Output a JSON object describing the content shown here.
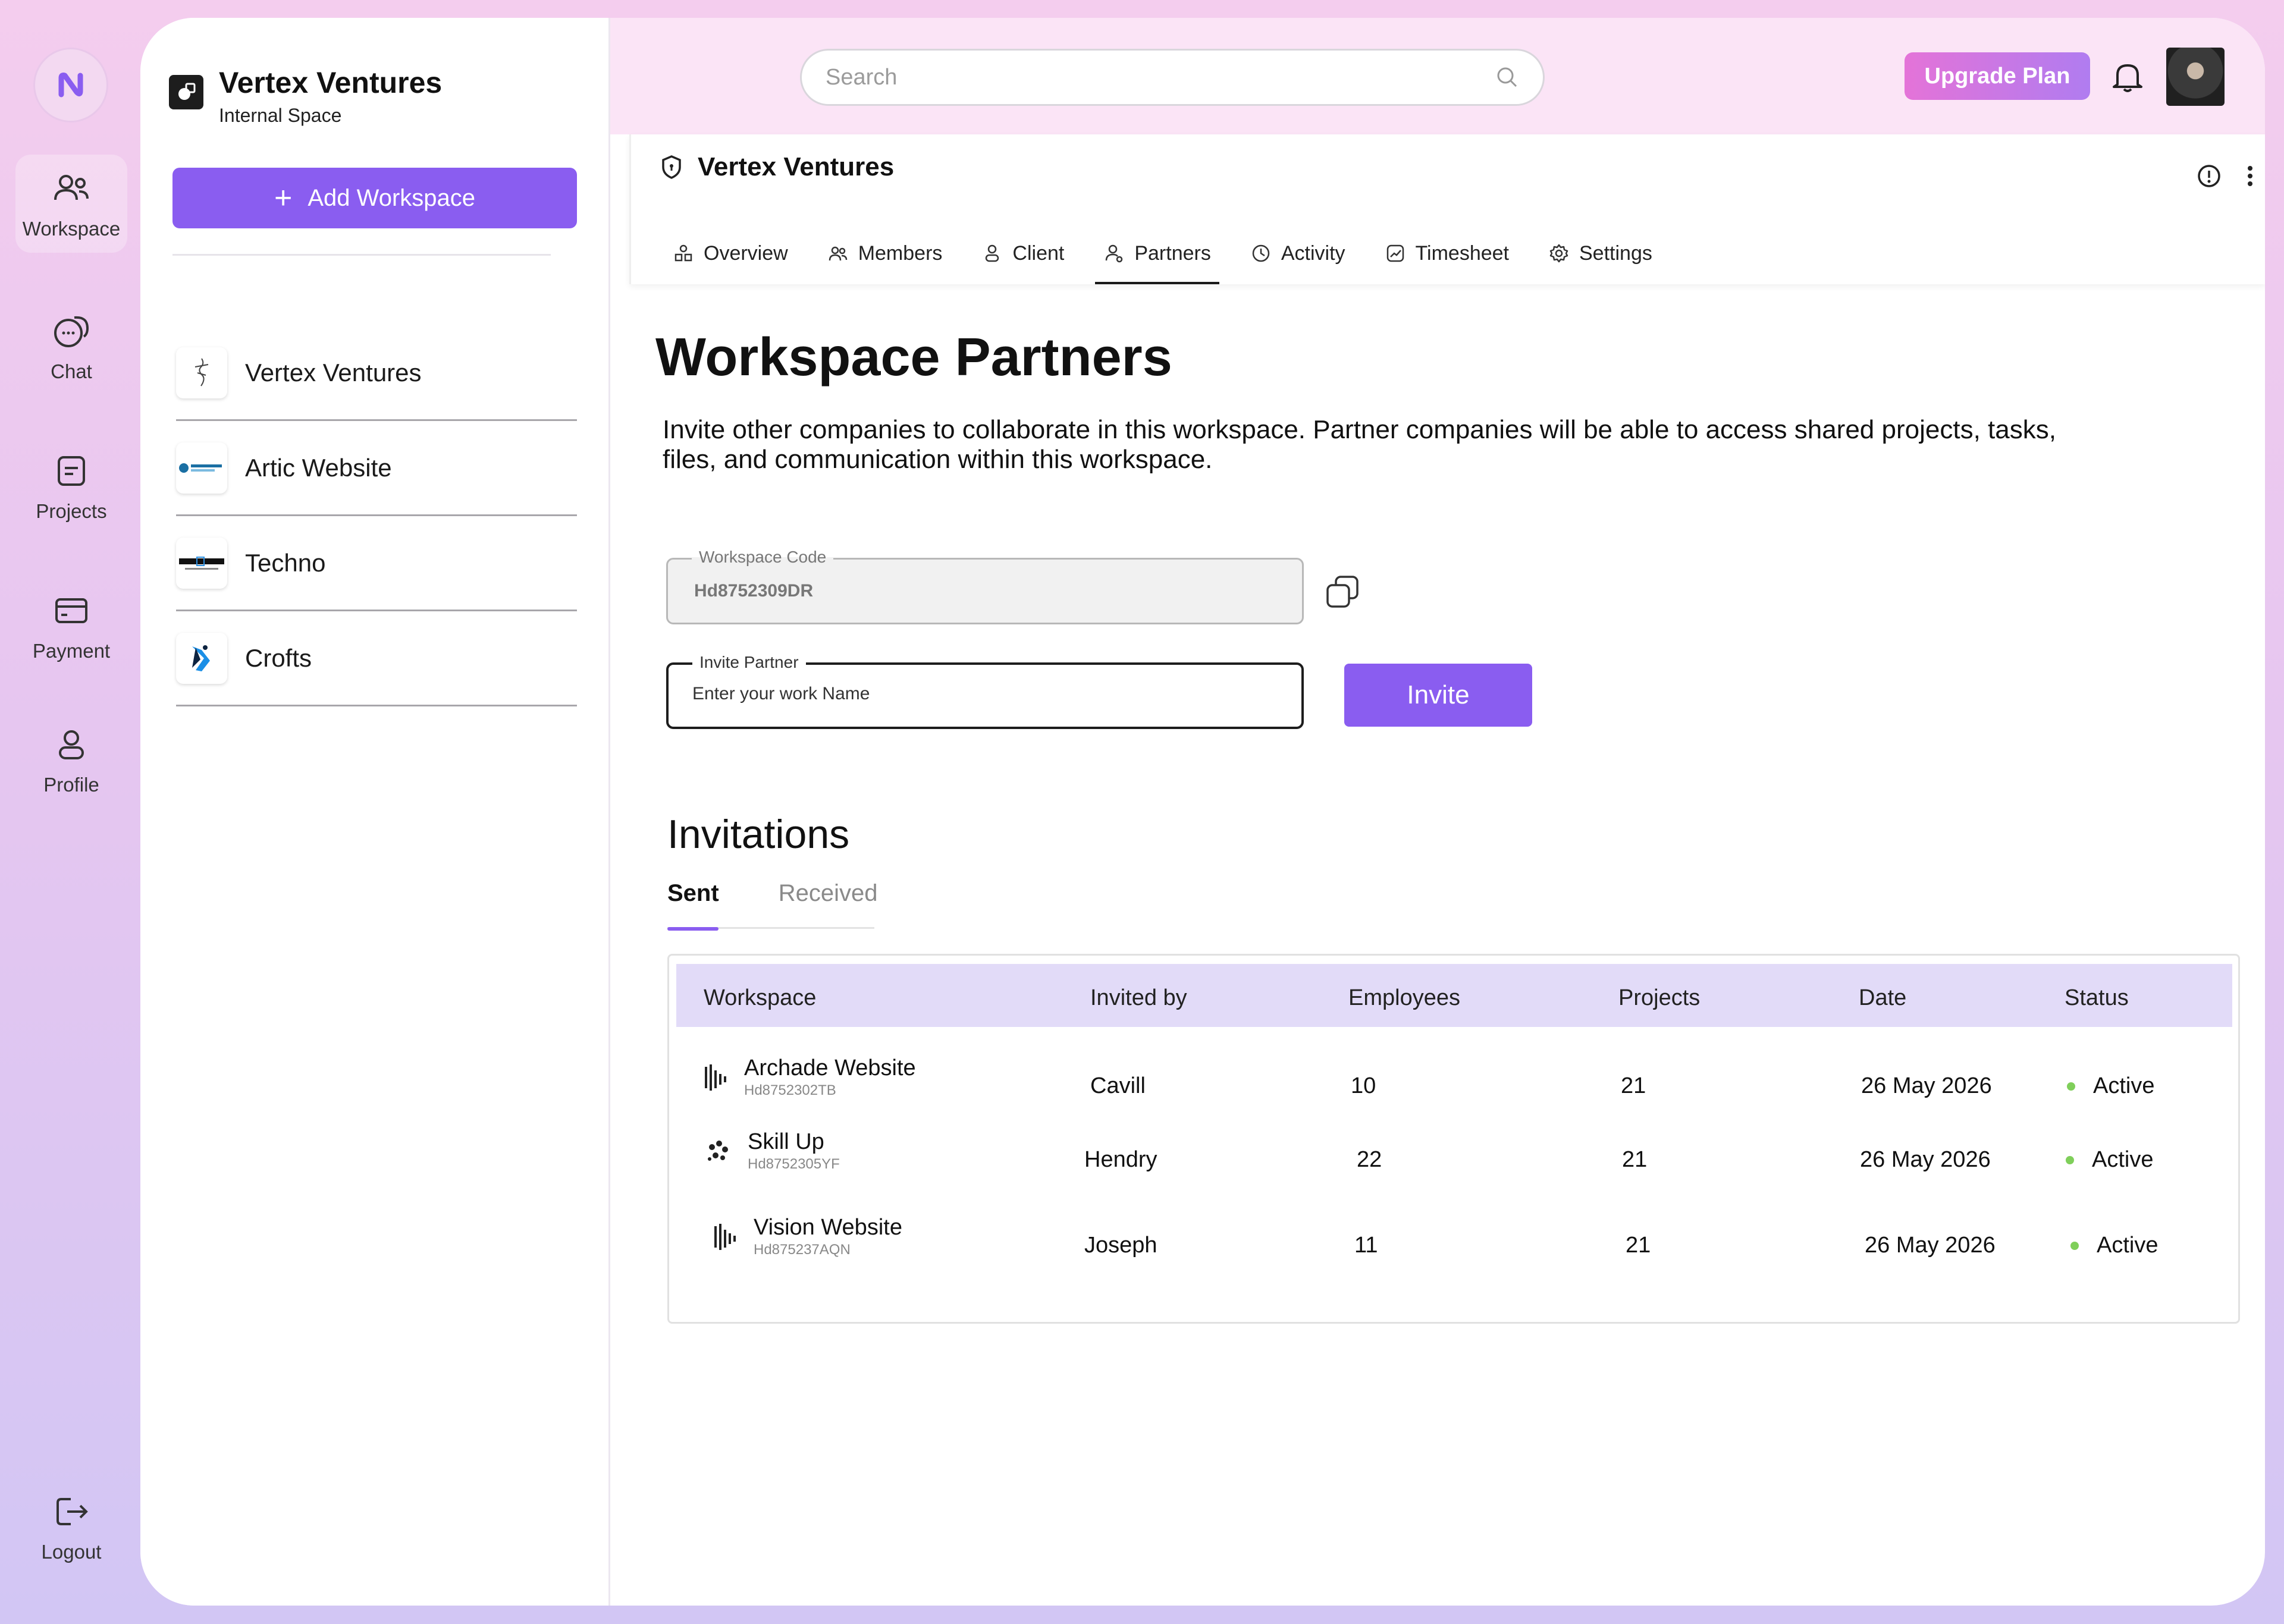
{
  "rail": {
    "items": [
      {
        "label": "Workspace",
        "icon": "users-icon"
      },
      {
        "label": "Chat",
        "icon": "chat-bubbles-icon"
      },
      {
        "label": "Projects",
        "icon": "document-icon"
      },
      {
        "label": "Payment",
        "icon": "card-icon"
      },
      {
        "label": "Profile",
        "icon": "person-icon"
      }
    ],
    "logout": "Logout"
  },
  "workspace_panel": {
    "title": "Vertex Ventures",
    "subtitle": "Internal Space",
    "add_button": "Add Workspace",
    "items": [
      {
        "name": "Vertex Ventures"
      },
      {
        "name": "Artic Website"
      },
      {
        "name": "Techno"
      },
      {
        "name": "Crofts"
      }
    ]
  },
  "topbar": {
    "search_placeholder": "Search",
    "upgrade_label": "Upgrade Plan"
  },
  "workspace_card": {
    "title": "Vertex Ventures",
    "tabs": [
      "Overview",
      "Members",
      "Client",
      "Partners",
      "Activity",
      "Timesheet",
      "Settings"
    ],
    "active_tab": "Partners"
  },
  "partners": {
    "title": "Workspace Partners",
    "description": "Invite other companies to collaborate in this workspace. Partner companies will be able to access shared projects, tasks, files, and communication within this workspace.",
    "code_label": "Workspace Code",
    "code_value": "Hd8752309DR",
    "invite_label": "Invite Partner",
    "invite_placeholder": "Enter your work Name",
    "invite_button": "Invite"
  },
  "invitations": {
    "title": "Invitations",
    "tabs": {
      "sent": "Sent",
      "received": "Received"
    },
    "columns": [
      "Workspace",
      "Invited by",
      "Employees",
      "Projects",
      "Date",
      "Status"
    ],
    "rows": [
      {
        "workspace": "Archade Website",
        "code": "Hd8752302TB",
        "invited_by": "Cavill",
        "employees": "10",
        "projects": "21",
        "date": "26 May 2026",
        "status": "Active"
      },
      {
        "workspace": "Skill Up",
        "code": "Hd8752305YF",
        "invited_by": "Hendry",
        "employees": "22",
        "projects": "21",
        "date": "26 May 2026",
        "status": "Active"
      },
      {
        "workspace": "Vision Website",
        "code": "Hd875237AQN",
        "invited_by": "Joseph",
        "employees": "11",
        "projects": "21",
        "date": "26 May 2026",
        "status": "Active"
      }
    ]
  },
  "colors": {
    "accent": "#8a5df0",
    "status_active": "#7fcf5a",
    "header_row": "#e2dbf8"
  }
}
